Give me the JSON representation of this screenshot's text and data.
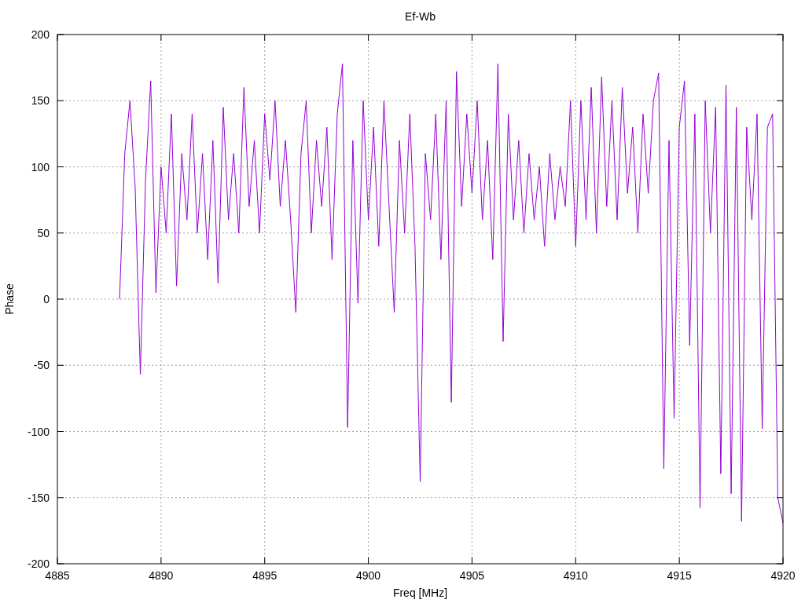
{
  "chart_data": {
    "type": "line",
    "title": "Ef-Wb",
    "xlabel": "Freq [MHz]",
    "ylabel": "Phase",
    "grid": true,
    "xlim": [
      4885,
      4920
    ],
    "ylim": [
      -200,
      200
    ],
    "xticks": [
      4885,
      4890,
      4895,
      4900,
      4905,
      4910,
      4915,
      4920
    ],
    "yticks": [
      -200,
      -150,
      -100,
      -50,
      0,
      50,
      100,
      150,
      200
    ],
    "x": [
      4888,
      4888.25,
      4888.5,
      4888.75,
      4889,
      4889.25,
      4889.5,
      4889.75,
      4890,
      4890.25,
      4890.5,
      4890.75,
      4891,
      4891.25,
      4891.5,
      4891.75,
      4892,
      4892.25,
      4892.5,
      4892.75,
      4893,
      4893.25,
      4893.5,
      4893.75,
      4894,
      4894.25,
      4894.5,
      4894.75,
      4895,
      4895.25,
      4895.5,
      4895.75,
      4896,
      4896.25,
      4896.5,
      4896.75,
      4897,
      4897.25,
      4897.5,
      4897.75,
      4898,
      4898.25,
      4898.5,
      4898.75,
      4899,
      4899.25,
      4899.5,
      4899.75,
      4900,
      4900.25,
      4900.5,
      4900.75,
      4901,
      4901.25,
      4901.5,
      4901.75,
      4902,
      4902.25,
      4902.5,
      4902.75,
      4903,
      4903.25,
      4903.5,
      4903.75,
      4904,
      4904.25,
      4904.5,
      4904.75,
      4905,
      4905.25,
      4905.5,
      4905.75,
      4906,
      4906.25,
      4906.5,
      4906.75,
      4907,
      4907.25,
      4907.5,
      4907.75,
      4908,
      4908.25,
      4908.5,
      4908.75,
      4909,
      4909.25,
      4909.5,
      4909.75,
      4910,
      4910.25,
      4910.5,
      4910.75,
      4911,
      4911.25,
      4911.5,
      4911.75,
      4912,
      4912.25,
      4912.5,
      4912.75,
      4913,
      4913.25,
      4913.5,
      4913.75,
      4914,
      4914.25,
      4914.5,
      4914.75,
      4915,
      4915.25,
      4915.5,
      4915.75,
      4916,
      4916.25,
      4916.5,
      4916.75,
      4917,
      4917.25,
      4917.5,
      4917.75,
      4918,
      4918.25,
      4918.5,
      4918.75,
      4919,
      4919.25,
      4919.5,
      4919.75,
      4920
    ],
    "series": [
      {
        "color": "#9400d3",
        "values": [
          0,
          110,
          150,
          85,
          -57,
          90,
          165,
          5,
          100,
          50,
          140,
          10,
          110,
          60,
          140,
          50,
          110,
          30,
          120,
          12,
          145,
          60,
          110,
          50,
          160,
          70,
          120,
          50,
          140,
          90,
          150,
          70,
          120,
          60,
          -10,
          110,
          150,
          50,
          120,
          70,
          130,
          30,
          140,
          178,
          -97,
          120,
          -3,
          150,
          60,
          130,
          40,
          150,
          70,
          -10,
          120,
          50,
          140,
          40,
          -138,
          110,
          60,
          140,
          30,
          150,
          -78,
          172,
          70,
          140,
          80,
          150,
          60,
          120,
          30,
          178,
          -32,
          140,
          60,
          120,
          50,
          110,
          60,
          100,
          40,
          110,
          60,
          100,
          70,
          150,
          40,
          150,
          60,
          160,
          50,
          168,
          70,
          150,
          60,
          160,
          80,
          130,
          50,
          140,
          80,
          150,
          171,
          -128,
          120,
          -90,
          130,
          165,
          -35,
          140,
          -158,
          150,
          50,
          145,
          -132,
          162,
          -147,
          145,
          -168,
          130,
          60,
          140,
          -98,
          130,
          140,
          -150,
          -169
        ]
      }
    ]
  }
}
